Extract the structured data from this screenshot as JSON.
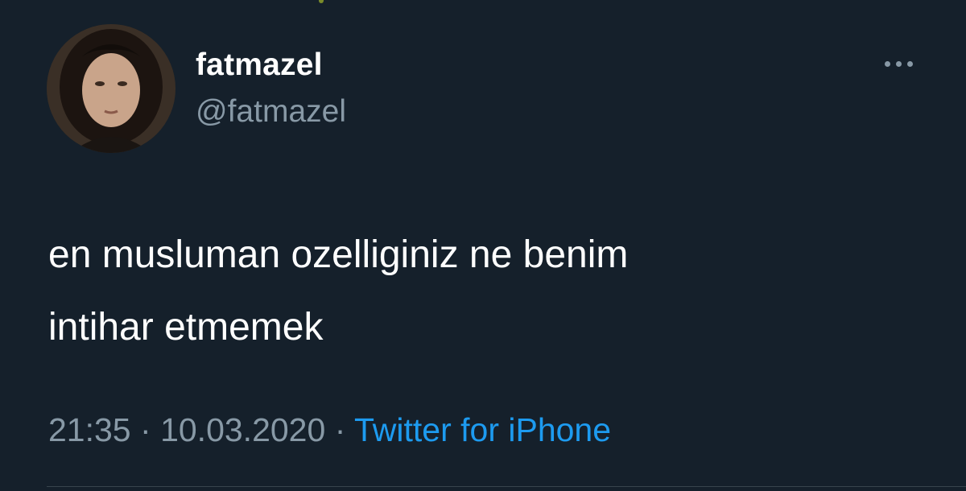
{
  "author": {
    "display_name": "fatmazel",
    "handle": "@fatmazel",
    "avatar_icon": "profile-photo"
  },
  "more_icon": "more-horizontal-icon",
  "tweet": {
    "lines": [
      "en musluman ozelliginiz ne benim",
      "intihar etmemek"
    ],
    "time": "21:35",
    "separator": "·",
    "date": "10.03.2020",
    "source": "Twitter for iPhone"
  },
  "colors": {
    "background": "#15202b",
    "primary_text": "#ffffff",
    "secondary_text": "#8899a6",
    "link": "#1d9bf0",
    "divider": "#38444d"
  }
}
